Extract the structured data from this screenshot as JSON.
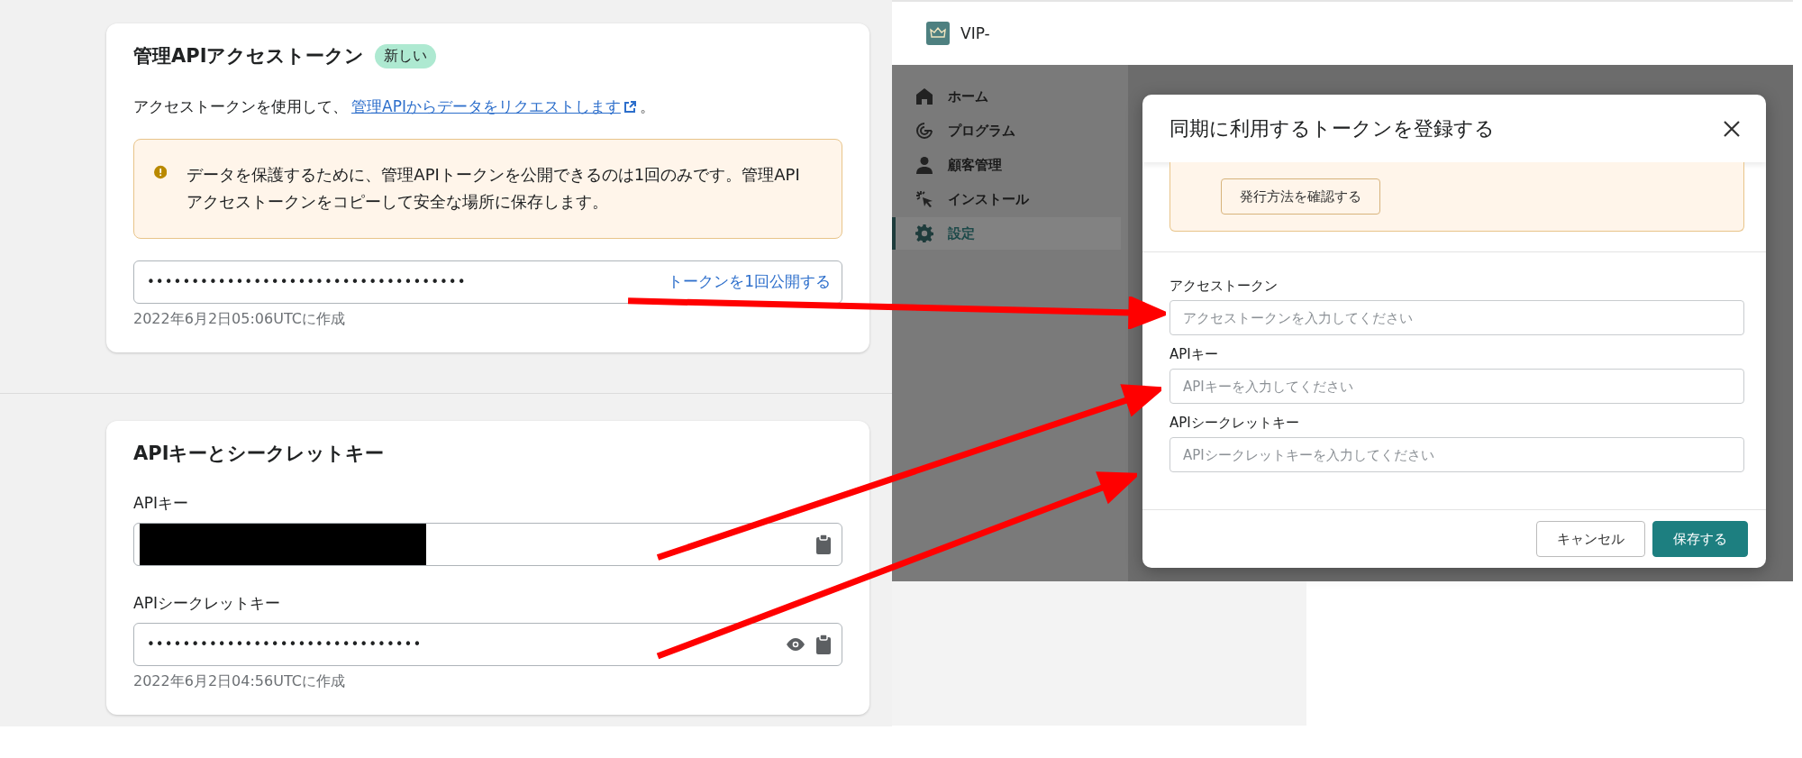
{
  "access_token_card": {
    "title": "管理APIアクセストークン",
    "badge": "新しい",
    "description": {
      "text": "アクセストークンを使用して、",
      "link": "管理APIからデータをリクエストします",
      "suffix": "。"
    },
    "warning": "データを保護するために、管理APIトークンを公開できるのは1回のみです。管理APIアクセストークンをコピーして安全な場所に保存します。",
    "token_field": {
      "value": "••••••••••••••••••••••••••••••••••••",
      "action": "トークンを1回公開する"
    },
    "created": "2022年6月2日05:06UTCに作成"
  },
  "keys_card": {
    "title": "APIキーとシークレットキー",
    "fields": [
      {
        "label": "APIキー",
        "kind": "redacted",
        "show_toggle": false
      },
      {
        "label": "APIシークレットキー",
        "kind": "masked",
        "value": "•••••••••••••••••••••••••••••••",
        "show_toggle": true
      }
    ],
    "created": "2022年6月2日04:56UTCに作成"
  },
  "app": {
    "brand": "VIP-",
    "nav": [
      {
        "label": "ホーム",
        "selected": false
      },
      {
        "label": "プログラム",
        "selected": false
      },
      {
        "label": "顧客管理",
        "selected": false
      },
      {
        "label": "インストール",
        "selected": false
      },
      {
        "label": "設定",
        "selected": true
      }
    ],
    "modal": {
      "title": "同期に利用するトークンを登録する",
      "warning_button": "発行方法を確認する",
      "fields": [
        {
          "label": "アクセストークン",
          "placeholder": "アクセストークンを入力してください"
        },
        {
          "label": "APIキー",
          "placeholder": "APIキーを入力してください"
        },
        {
          "label": "APIシークレットキー",
          "placeholder": "APIシークレットキーを入力してください"
        }
      ],
      "buttons": [
        {
          "label": "キャンセル",
          "kind": "secondary"
        },
        {
          "label": "保存する",
          "kind": "primary"
        }
      ]
    }
  }
}
